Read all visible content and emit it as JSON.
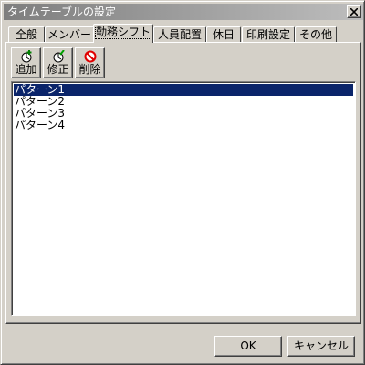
{
  "window": {
    "title": "タイムテーブルの設定"
  },
  "tabs": [
    {
      "label": "全般",
      "active": false
    },
    {
      "label": "メンバー",
      "active": false
    },
    {
      "label": "勤務シフト",
      "active": true
    },
    {
      "label": "人員配置",
      "active": false
    },
    {
      "label": "休日",
      "active": false
    },
    {
      "label": "印刷設定",
      "active": false
    },
    {
      "label": "その他",
      "active": false
    }
  ],
  "toolbar": {
    "add_label": "追加",
    "edit_label": "修正",
    "delete_label": "削除"
  },
  "list": {
    "items": [
      "パターン1",
      "パターン2",
      "パターン3",
      "パターン4"
    ],
    "selected_index": 0
  },
  "footer": {
    "ok_label": "OK",
    "cancel_label": "キャンセル"
  },
  "colors": {
    "selection": "#0a246a",
    "face": "#d4d0c8",
    "titlebar": "#7e7e7e"
  }
}
